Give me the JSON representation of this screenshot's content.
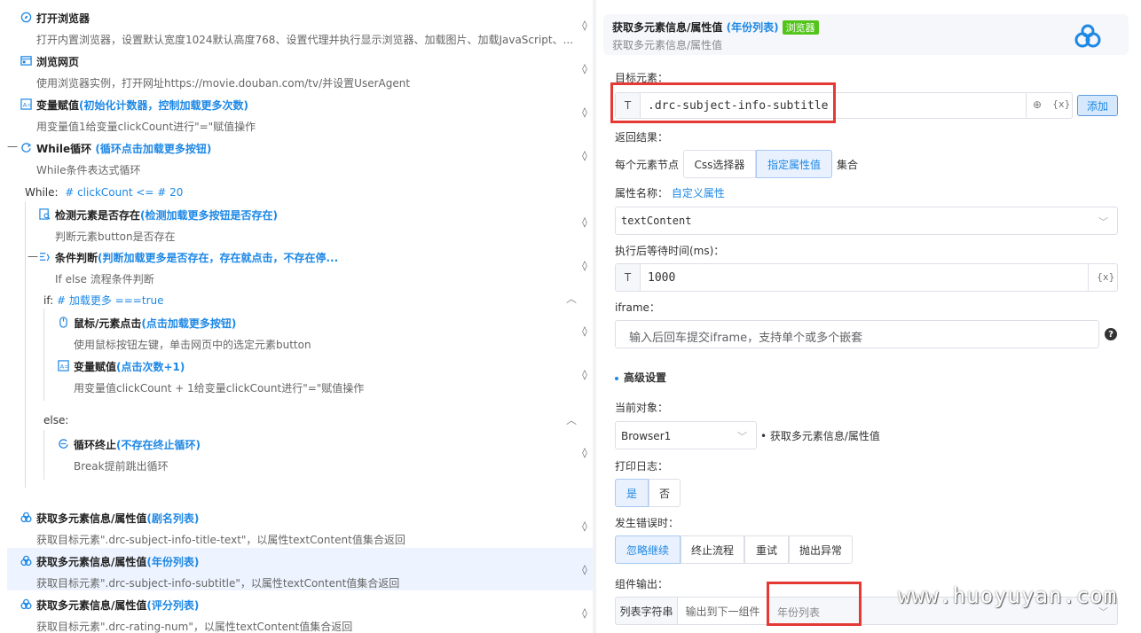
{
  "steps": [
    {
      "title": "打开浏览器",
      "hl": "",
      "desc": "打开内置浏览器，设置默认宽度1024默认高度768、设置代理并执行显示浏览器、加载图片、加载JavaScript、...",
      "icon": "compass-icon"
    },
    {
      "title": "浏览网页",
      "hl": "",
      "desc": "使用浏览器实例，打开网址https://movie.douban.com/tv/并设置UserAgent",
      "icon": "browser-window-icon"
    },
    {
      "title": "变量赋值",
      "hl": "(初始化计数器，控制加载更多次数)",
      "desc": "用变量值1给变量clickCount进行\"=\"赋值操作",
      "icon": "variable-assign-icon"
    },
    {
      "title": "While循环",
      "hl": "(循环点击加载更多按钮)",
      "desc": "While条件表达式循环",
      "icon": "loop-icon"
    },
    {
      "title": "检测元素是否存在",
      "hl": "(检测加载更多按钮是否存在)",
      "desc": "判断元素button是否存在",
      "icon": "element-check-icon"
    },
    {
      "title": "条件判断",
      "hl": "(判断加载更多是否存在，存在就点击，不存在停...",
      "desc": "If else 流程条件判断",
      "icon": "condition-branch-icon"
    },
    {
      "title": "鼠标/元素点击",
      "hl": "(点击加载更多按钮)",
      "desc": "使用鼠标按钮左键，单击网页中的选定元素button",
      "icon": "mouse-icon"
    },
    {
      "title": "变量赋值",
      "hl": "(点击次数+1)",
      "desc": "用变量值clickCount + 1给变量clickCount进行\"=\"赋值操作",
      "icon": "variable-assign-icon"
    },
    {
      "title": "循环终止",
      "hl": "(不存在终止循环)",
      "desc": "Break提前跳出循环",
      "icon": "loop-break-icon"
    },
    {
      "title": "获取多元素信息/属性值",
      "hl": "(剧名列表)",
      "desc": "获取目标元素\".drc-subject-info-title-text\"，以属性textContent值集合返回",
      "icon": "cloud-fetch-icon"
    },
    {
      "title": "获取多元素信息/属性值",
      "hl": "(年份列表)",
      "desc": "获取目标元素\".drc-subject-info-subtitle\"，以属性textContent值集合返回",
      "icon": "cloud-fetch-icon"
    },
    {
      "title": "获取多元素信息/属性值",
      "hl": "(评分列表)",
      "desc": "获取目标元素\".drc-rating-num\"，以属性textContent值集合返回",
      "icon": "cloud-fetch-icon"
    }
  ],
  "labels": {
    "while_prefix": "While:",
    "while_cond": "# clickCount <= # 20",
    "if_prefix": "if:",
    "if_cond": "# 加载更多 ===true",
    "else": "else:"
  },
  "panel": {
    "title": "获取多元素信息/属性值",
    "title_hl": "(年份列表)",
    "badge": "浏览器",
    "subtitle": "获取多元素信息/属性值",
    "target_label": "目标元素：",
    "target_value": ".drc-subject-info-subtitle",
    "t_btn": "T",
    "var_btn": "{x}",
    "add_btn": "添加",
    "return_label": "返回结果：",
    "each_node": "每个元素节点",
    "opt_css": "Css选择器",
    "opt_attr": "指定属性值",
    "collection": "集合",
    "attr_name_label": "属性名称：",
    "attr_custom": "自定义属性",
    "attr_value": "textContent",
    "wait_label": "执行后等待时间(ms)：",
    "wait_value": "1000",
    "iframe_label": "iframe：",
    "iframe_placeholder": "输入后回车提交iframe，支持单个或多个嵌套",
    "help": "?",
    "advanced": "高级设置",
    "current_obj_label": "当前对象：",
    "current_obj_value": "Browser1",
    "current_obj_suffix": "• 获取多元素信息/属性值",
    "log_label": "打印日志：",
    "log_yes": "是",
    "log_no": "否",
    "error_label": "发生错误时：",
    "err_opts": [
      "忽略继续",
      "终止流程",
      "重试",
      "抛出异常"
    ],
    "output_label": "组件输出：",
    "out_type": "列表字符串",
    "out_next": "输出到下一组件",
    "out_value": "年份列表"
  },
  "watermark": "www.huoyuyan.com",
  "colors": {
    "accent": "#1e88e5",
    "highlight_box": "#e53935",
    "badge": "#52c41a"
  }
}
